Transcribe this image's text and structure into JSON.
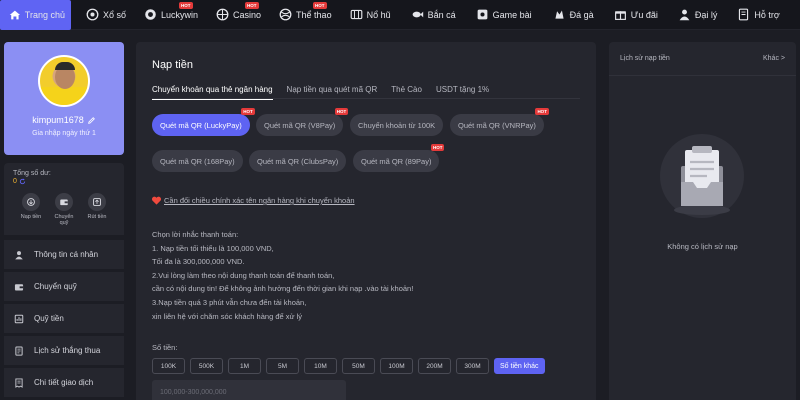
{
  "nav": {
    "items": [
      {
        "label": "Trang chủ",
        "icon": "home-icon",
        "active": true,
        "hot": false
      },
      {
        "label": "Xổ số",
        "icon": "lottery-icon",
        "active": false,
        "hot": false
      },
      {
        "label": "Luckywin",
        "icon": "luckywin-icon",
        "active": false,
        "hot": true
      },
      {
        "label": "Casino",
        "icon": "casino-icon",
        "active": false,
        "hot": true
      },
      {
        "label": "Thể thao",
        "icon": "sports-icon",
        "active": false,
        "hot": true
      },
      {
        "label": "Nổ hũ",
        "icon": "slot-icon",
        "active": false,
        "hot": false
      },
      {
        "label": "Bắn cá",
        "icon": "fish-icon",
        "active": false,
        "hot": false
      },
      {
        "label": "Game bài",
        "icon": "cards-icon",
        "active": false,
        "hot": false
      },
      {
        "label": "Đá gà",
        "icon": "cockfight-icon",
        "active": false,
        "hot": false
      },
      {
        "label": "Ưu đãi",
        "icon": "gift-icon",
        "active": false,
        "hot": false
      },
      {
        "label": "Đại lý",
        "icon": "agent-icon",
        "active": false,
        "hot": false
      },
      {
        "label": "Hỗ trợ",
        "icon": "support-icon",
        "active": false,
        "hot": false
      }
    ],
    "hot_label": "HOT"
  },
  "profile": {
    "username": "kimpum1678",
    "joined": "Gia nhập ngày thứ 1"
  },
  "balance": {
    "label": "Tổng số dư:",
    "value": "0"
  },
  "quick_actions": [
    {
      "label": "Nạp tiền",
      "icon": "deposit-icon"
    },
    {
      "label": "Chuyển quỹ",
      "icon": "wallet-icon"
    },
    {
      "label": "Rút tiền",
      "icon": "withdraw-icon"
    }
  ],
  "menu": [
    {
      "label": "Thông tin cá nhân",
      "icon": "user-icon"
    },
    {
      "label": "Chuyển quỹ",
      "icon": "wallet-icon"
    },
    {
      "label": "Quỹ tiền",
      "icon": "fund-icon"
    },
    {
      "label": "Lịch sử thắng thua",
      "icon": "history-icon"
    },
    {
      "label": "Chi tiết giao dịch",
      "icon": "receipt-icon"
    }
  ],
  "main": {
    "title": "Nạp tiền",
    "tabs": [
      "Chuyển khoản qua thẻ ngân hàng",
      "Nạp tiền qua quét mã QR",
      "Thẻ Cào",
      "USDT tặng 1%"
    ],
    "methods": [
      {
        "label": "Quét mã QR (LuckyPay)",
        "active": true,
        "hot": true
      },
      {
        "label": "Quét mã QR (V8Pay)",
        "active": false,
        "hot": true
      },
      {
        "label": "Chuyển khoản từ 100K",
        "active": false,
        "hot": false
      },
      {
        "label": "Quét mã QR (VNRPay)",
        "active": false,
        "hot": true
      },
      {
        "label": "Quét mã QR (168Pay)",
        "active": false,
        "hot": false
      },
      {
        "label": "Quét mã QR (ClubsPay)",
        "active": false,
        "hot": false
      },
      {
        "label": "Quét mã QR (89Pay)",
        "active": false,
        "hot": true
      }
    ],
    "notice": "Cần đổi chiều chính xác tên ngân hàng khi chuyển khoản",
    "instructions": [
      "Chọn lời nhắc thanh toán:",
      "1. Nạp tiền tối thiểu là 100,000 VND,",
      "Tối đa là 300,000,000 VND.",
      "2.Vui lòng làm theo nội dung thanh toán để thanh toán,",
      "cần có nội dung tin! Để không ảnh hưởng đến thời gian khi nạp .vào tài khoản!",
      "3.Nạp tiền quá 3 phút vẫn chưa đến tài khoản,",
      "xin liên hệ với chăm sóc khách hàng để xử lý"
    ],
    "amount_label": "Số tiền:",
    "amounts": [
      "100K",
      "500K",
      "1M",
      "5M",
      "10M",
      "50M",
      "100M",
      "200M",
      "300M"
    ],
    "other_amount": "Số tiền khác",
    "amount_placeholder": "100,000-300,000,000"
  },
  "history": {
    "title": "Lịch sử nạp tiền",
    "more": "Khác >",
    "empty": "Không có lịch sử nạp"
  },
  "colors": {
    "accent": "#5e63f2",
    "profile_bg": "#8b8ff3",
    "hot": "#e43a3a",
    "balance": "#f2b531"
  }
}
